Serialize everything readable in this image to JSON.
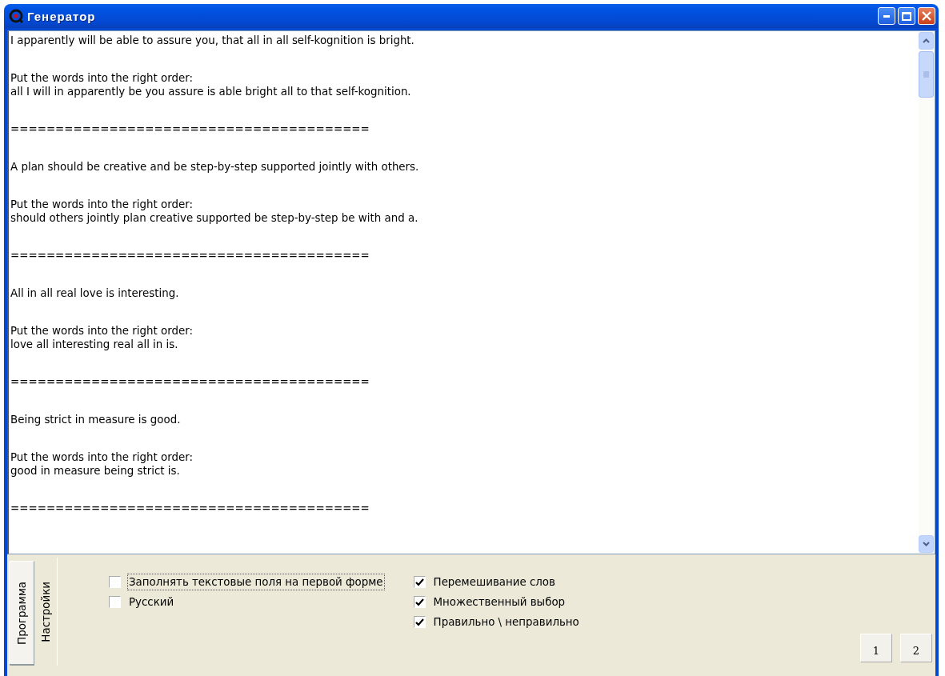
{
  "window": {
    "title": "Генератор"
  },
  "text_area": {
    "paragraphs": [
      {
        "lines": [
          "I apparently will be able to assure you, that all in all self-kognition is bright."
        ]
      },
      {
        "lines": [
          "Put the words into the right order:",
          "all I will in apparently be you assure is able bright all to that self-kognition."
        ]
      },
      {
        "lines": [
          "========================================"
        ]
      },
      {
        "lines": [
          "A plan should be creative and be step-by-step supported jointly with others."
        ]
      },
      {
        "lines": [
          "Put the words into the right order:",
          "should others jointly plan creative supported be step-by-step be with and a."
        ]
      },
      {
        "lines": [
          "========================================"
        ]
      },
      {
        "lines": [
          "All in all real love is interesting."
        ]
      },
      {
        "lines": [
          "Put the words into the right order:",
          "love all interesting real all in is."
        ]
      },
      {
        "lines": [
          "========================================"
        ]
      },
      {
        "lines": [
          "Being strict in measure is good."
        ]
      },
      {
        "lines": [
          "Put the words into the right order:",
          "good in measure being strict is."
        ]
      },
      {
        "lines": [
          "========================================"
        ]
      }
    ]
  },
  "tabs": [
    {
      "label": "Программа",
      "selected": true
    },
    {
      "label": "Настройки",
      "selected": false
    }
  ],
  "options_left": [
    {
      "label": "Заполнять текстовые поля на первой форме",
      "checked": false,
      "focused": true
    },
    {
      "label": "Русский",
      "checked": false,
      "focused": false
    }
  ],
  "options_right": [
    {
      "label": "Перемешивание слов",
      "checked": true,
      "focused": false
    },
    {
      "label": "Множественный выбор",
      "checked": true,
      "focused": false
    },
    {
      "label": "Правильно \\ неправильно",
      "checked": true,
      "focused": false
    }
  ],
  "page_buttons": [
    "1",
    "2"
  ]
}
